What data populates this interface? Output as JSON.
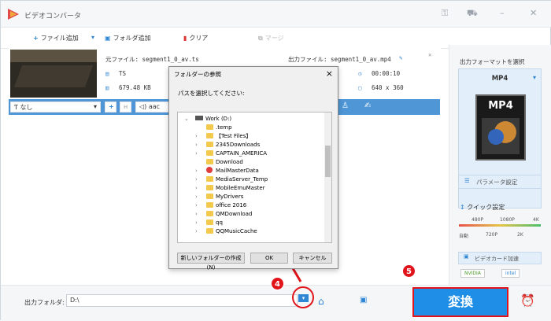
{
  "window": {
    "title": "ビデオコンバータ"
  },
  "toolbar": {
    "add_file": "ファイル追加",
    "add_folder": "フォルダ追加",
    "clear": "クリア",
    "merge": "マージ"
  },
  "file": {
    "source_label": "元ファイル: segment1_0_av.ts",
    "output_label": "出力ファイル: segment1_0_av.mp4",
    "src_format": "TS",
    "src_size": "679.48 KB",
    "duration": "00:00:10",
    "resolution": "640 x 360",
    "subtitle": "なし",
    "audio": "aac"
  },
  "sidebar": {
    "title": "出力フォーマットを選択",
    "format": "MP4",
    "format_icon": "MP4",
    "param_button": "パラメータ設定",
    "quick": "クイック設定",
    "q480": "480P",
    "q1080": "1080P",
    "q4k": "4K",
    "qauto": "自動",
    "q720": "720P",
    "q2k": "2K",
    "gpu": "ビデオカード加速",
    "nvidia": "NVIDIA",
    "intel": "intel"
  },
  "bottom": {
    "output_label": "出力フォルダ:",
    "path": "D:\\",
    "convert": "変換"
  },
  "dialog": {
    "title": "フォルダーの参照",
    "prompt": "パスを選択してください:",
    "close": "×",
    "items": [
      {
        "label": "Work (D:)",
        "type": "drive",
        "level": 0,
        "arrow": "⌄"
      },
      {
        "label": ".temp",
        "type": "folder",
        "level": 1,
        "arrow": ""
      },
      {
        "label": "【Test Files】",
        "type": "folder",
        "level": 1,
        "arrow": "›"
      },
      {
        "label": "2345Downloads",
        "type": "folder",
        "level": 1,
        "arrow": "›"
      },
      {
        "label": "CAPTAIN_AMERICA",
        "type": "folder",
        "level": 1,
        "arrow": "›"
      },
      {
        "label": "Download",
        "type": "folder",
        "level": 1,
        "arrow": ""
      },
      {
        "label": "MailMasterData",
        "type": "red",
        "level": 1,
        "arrow": "›"
      },
      {
        "label": "MediaServer_Temp",
        "type": "folder",
        "level": 1,
        "arrow": "›"
      },
      {
        "label": "MobileEmuMaster",
        "type": "folder",
        "level": 1,
        "arrow": "›"
      },
      {
        "label": "MyDrivers",
        "type": "folder",
        "level": 1,
        "arrow": "›"
      },
      {
        "label": "office 2016",
        "type": "folder",
        "level": 1,
        "arrow": "›"
      },
      {
        "label": "QMDownload",
        "type": "folder",
        "level": 1,
        "arrow": "›"
      },
      {
        "label": "qq",
        "type": "folder",
        "level": 1,
        "arrow": "›"
      },
      {
        "label": "QQMusicCache",
        "type": "folder",
        "level": 1,
        "arrow": "›"
      }
    ],
    "new_folder": "新しいフォルダーの作成(N)",
    "ok": "OK",
    "cancel": "キャンセル"
  },
  "badges": {
    "step4": "4",
    "step5": "5"
  },
  "colors": {
    "accent": "#1f8ee6",
    "highlight": "#e0141a",
    "band": "#4f96d6"
  }
}
